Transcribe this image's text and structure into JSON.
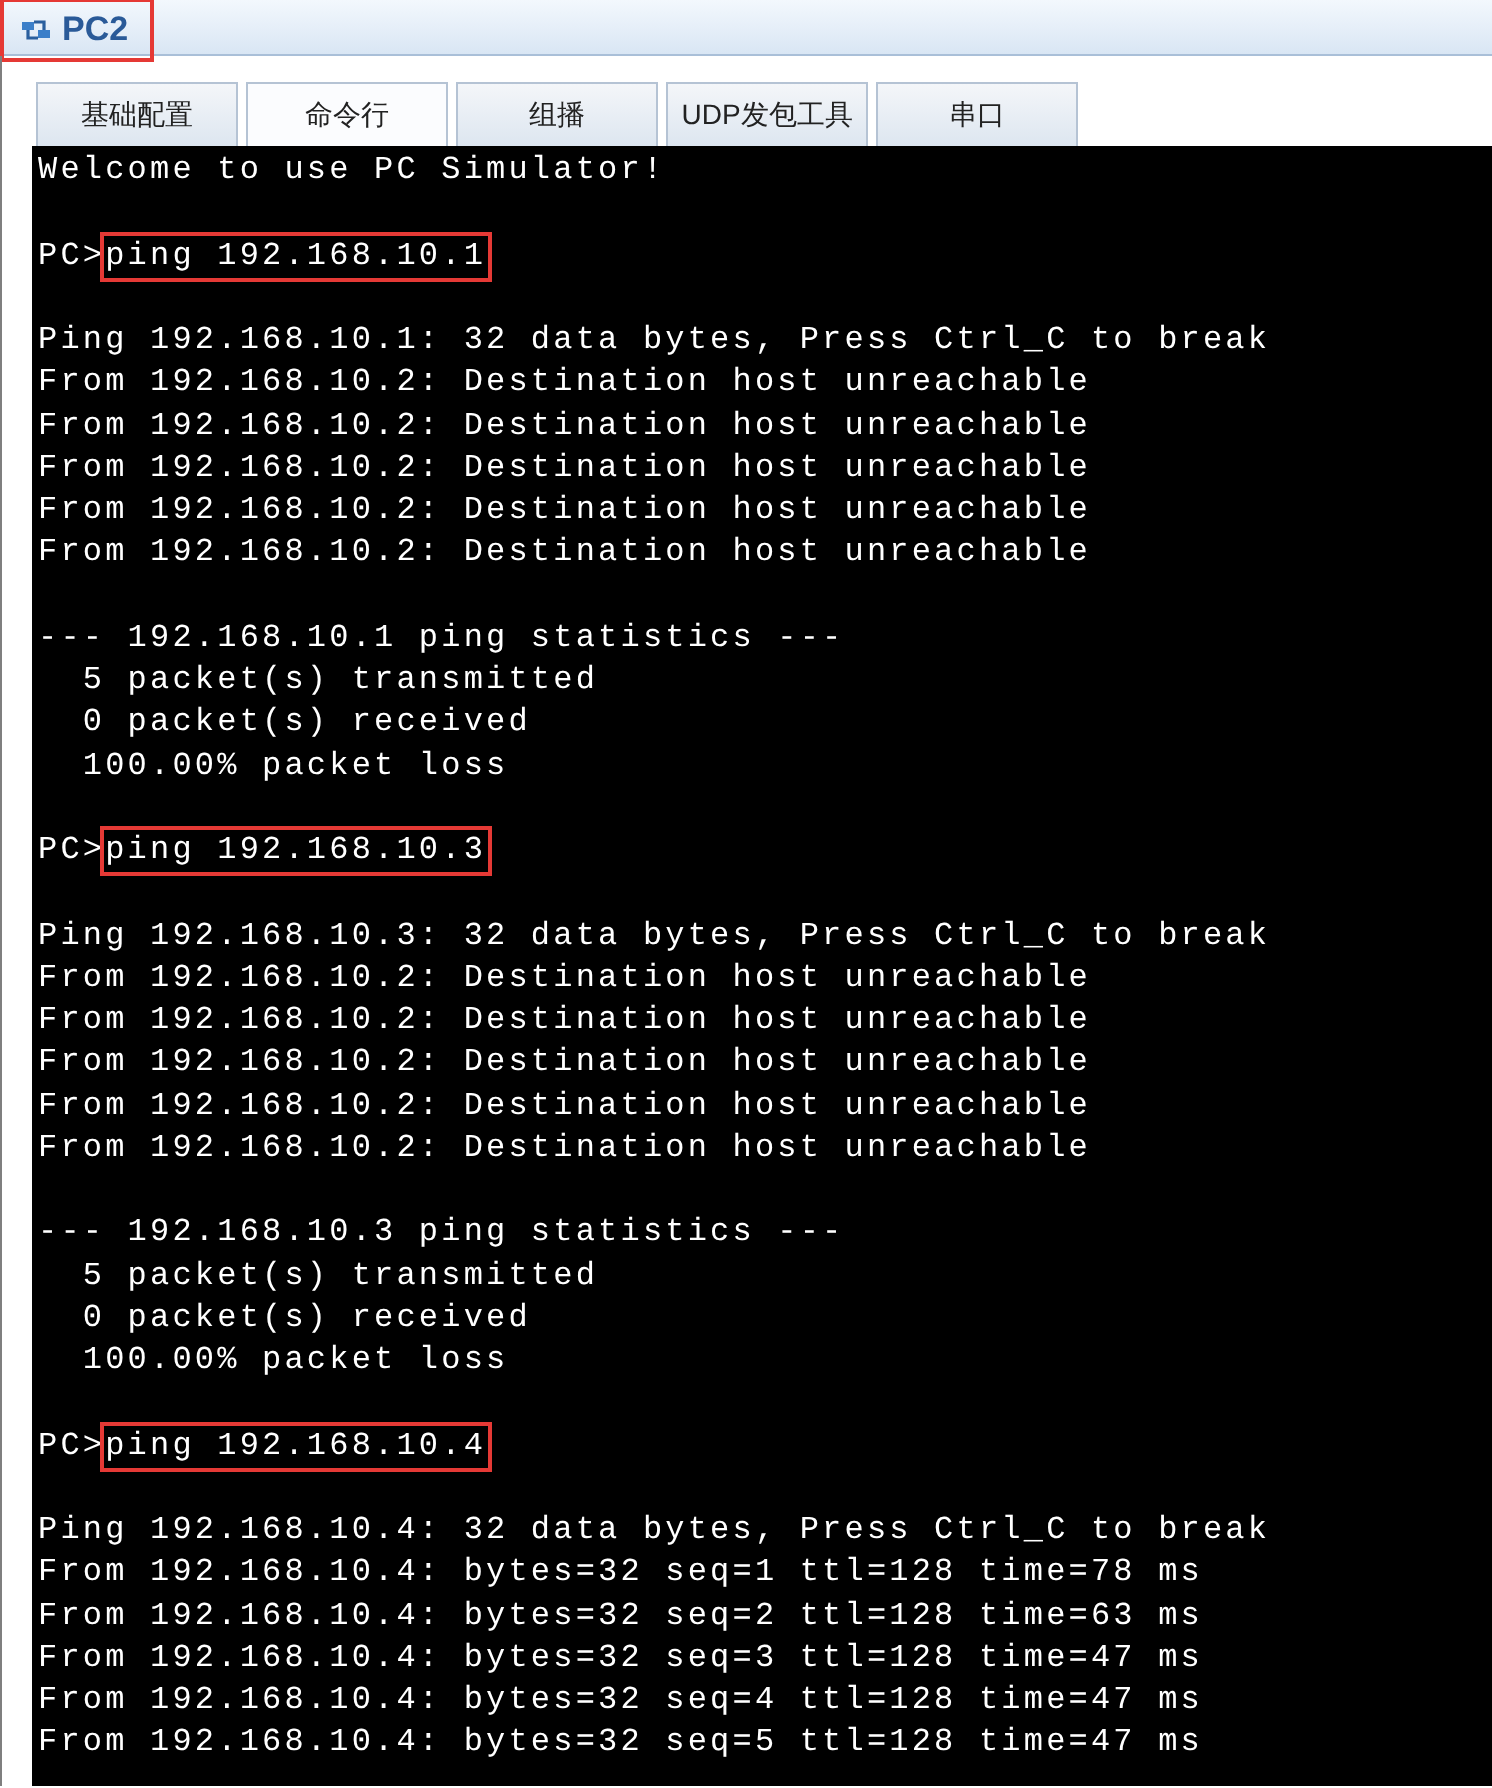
{
  "window": {
    "title": "PC2",
    "title_highlighted": true
  },
  "tabs": [
    {
      "label": "基础配置",
      "selected": false
    },
    {
      "label": "命令行",
      "selected": true
    },
    {
      "label": "组播",
      "selected": false
    },
    {
      "label": "UDP发包工具",
      "selected": false
    },
    {
      "label": "串口",
      "selected": false
    }
  ],
  "terminal": {
    "lines": [
      {
        "kind": "output",
        "text": "Welcome to use PC Simulator!"
      },
      {
        "kind": "blank"
      },
      {
        "kind": "command",
        "prompt": "PC>",
        "command": "ping 192.168.10.1",
        "highlighted": true
      },
      {
        "kind": "blank"
      },
      {
        "kind": "output",
        "text": "Ping 192.168.10.1: 32 data bytes, Press Ctrl_C to break"
      },
      {
        "kind": "output",
        "text": "From 192.168.10.2: Destination host unreachable"
      },
      {
        "kind": "output",
        "text": "From 192.168.10.2: Destination host unreachable"
      },
      {
        "kind": "output",
        "text": "From 192.168.10.2: Destination host unreachable"
      },
      {
        "kind": "output",
        "text": "From 192.168.10.2: Destination host unreachable"
      },
      {
        "kind": "output",
        "text": "From 192.168.10.2: Destination host unreachable"
      },
      {
        "kind": "blank"
      },
      {
        "kind": "output",
        "text": "--- 192.168.10.1 ping statistics ---"
      },
      {
        "kind": "output",
        "text": "  5 packet(s) transmitted"
      },
      {
        "kind": "output",
        "text": "  0 packet(s) received"
      },
      {
        "kind": "output",
        "text": "  100.00% packet loss"
      },
      {
        "kind": "blank"
      },
      {
        "kind": "command",
        "prompt": "PC>",
        "command": "ping 192.168.10.3",
        "highlighted": true
      },
      {
        "kind": "blank"
      },
      {
        "kind": "output",
        "text": "Ping 192.168.10.3: 32 data bytes, Press Ctrl_C to break"
      },
      {
        "kind": "output",
        "text": "From 192.168.10.2: Destination host unreachable"
      },
      {
        "kind": "output",
        "text": "From 192.168.10.2: Destination host unreachable"
      },
      {
        "kind": "output",
        "text": "From 192.168.10.2: Destination host unreachable"
      },
      {
        "kind": "output",
        "text": "From 192.168.10.2: Destination host unreachable"
      },
      {
        "kind": "output",
        "text": "From 192.168.10.2: Destination host unreachable"
      },
      {
        "kind": "blank"
      },
      {
        "kind": "output",
        "text": "--- 192.168.10.3 ping statistics ---"
      },
      {
        "kind": "output",
        "text": "  5 packet(s) transmitted"
      },
      {
        "kind": "output",
        "text": "  0 packet(s) received"
      },
      {
        "kind": "output",
        "text": "  100.00% packet loss"
      },
      {
        "kind": "blank"
      },
      {
        "kind": "command",
        "prompt": "PC>",
        "command": "ping 192.168.10.4",
        "highlighted": true
      },
      {
        "kind": "blank"
      },
      {
        "kind": "output",
        "text": "Ping 192.168.10.4: 32 data bytes, Press Ctrl_C to break"
      },
      {
        "kind": "output",
        "text": "From 192.168.10.4: bytes=32 seq=1 ttl=128 time=78 ms"
      },
      {
        "kind": "output",
        "text": "From 192.168.10.4: bytes=32 seq=2 ttl=128 time=63 ms"
      },
      {
        "kind": "output",
        "text": "From 192.168.10.4: bytes=32 seq=3 ttl=128 time=47 ms"
      },
      {
        "kind": "output",
        "text": "From 192.168.10.4: bytes=32 seq=4 ttl=128 time=47 ms"
      },
      {
        "kind": "output",
        "text": "From 192.168.10.4: bytes=32 seq=5 ttl=128 time=47 ms"
      }
    ]
  }
}
